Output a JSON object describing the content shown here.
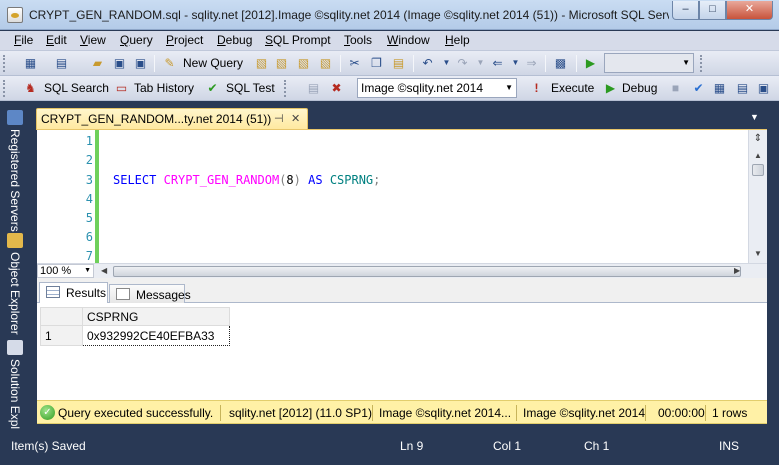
{
  "window": {
    "title": "CRYPT_GEN_RANDOM.sql - sqlity.net [2012].Image ©sqlity.net 2014 (Image ©sqlity.net 2014 (51)) - Microsoft SQL Server Management Studio",
    "minimize_glyph": "–",
    "maximize_glyph": "□",
    "close_glyph": "✕"
  },
  "menu": {
    "items": [
      "File",
      "Edit",
      "View",
      "Query",
      "Project",
      "Debug",
      "SQL Prompt",
      "Tools",
      "Window",
      "Help"
    ]
  },
  "toolbar1": {
    "new_query_label": "New Query"
  },
  "toolbar2": {
    "sql_search_label": "SQL Search",
    "tab_history_label": "Tab History",
    "sql_test_label": "SQL Test",
    "database_selected": "Image ©sqlity.net 2014",
    "execute_label": "Execute",
    "debug_label": "Debug"
  },
  "side_rail": {
    "items": [
      "Registered Servers",
      "Object Explorer",
      "Solution Expl"
    ]
  },
  "document_tab": {
    "label": "CRYPT_GEN_RANDOM...ty.net 2014 (51))",
    "pin_glyph": "⊣",
    "close_glyph": "✕"
  },
  "editor": {
    "line_numbers": [
      "1",
      "2",
      "3",
      "4",
      "5",
      "6",
      "7"
    ],
    "code": {
      "select": "SELECT",
      "function": "CRYPT_GEN_RANDOM",
      "open_paren": "(",
      "arg": "8",
      "close_paren": ")",
      "as": "AS",
      "alias": "CSPRNG",
      "semicolon": ";"
    },
    "zoom": "100 %"
  },
  "results": {
    "tabs": [
      "Results",
      "Messages"
    ],
    "columns": [
      "CSPRNG"
    ],
    "rows": [
      {
        "row_number": "1",
        "values": [
          "0x932992CE40EFBA33"
        ]
      }
    ]
  },
  "query_status": {
    "message": "Query executed successfully.",
    "server": "sqlity.net [2012] (11.0 SP1)",
    "login": "Image ©sqlity.net 2014...",
    "database": "Image ©sqlity.net 2014",
    "elapsed": "00:00:00",
    "row_count": "1 rows"
  },
  "app_status": {
    "message": "Item(s) Saved",
    "line": "Ln 9",
    "column": "Col 1",
    "char": "Ch 1",
    "mode": "INS"
  },
  "colors": {
    "accent_dark": "#293955",
    "tab_active": "#ffe89e",
    "status_yellow": "#fff1a6",
    "keyword_blue": "#0000ff",
    "function_magenta": "#ff00ff",
    "change_green": "#6ed05b",
    "line_number": "#2b91af"
  }
}
